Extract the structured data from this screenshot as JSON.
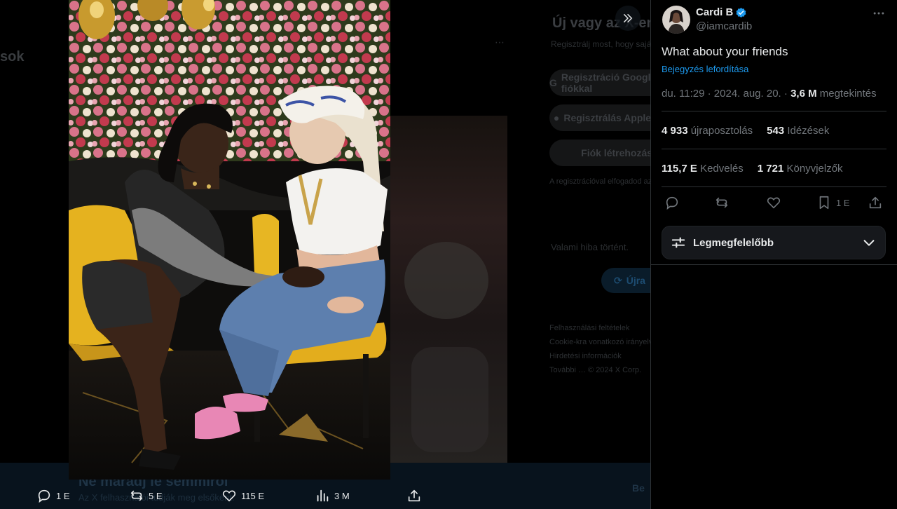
{
  "background": {
    "side_text": "sok",
    "signup_title": "Új vagy az X-en?",
    "signup_subtitle": "Regisztrálj most, hogy saját személyre szabott idővonalad lehessen!",
    "google_button": "Regisztráció Google-fiókkal",
    "apple_button": "Regisztrálás Apple-fiókkal",
    "create_account_button": "Fiók létrehozása",
    "fineprint": "A regisztrációval elfogadod az Általános Szerződési Feltételeket és az Adatvédelmi szabályzatot, beleértve a Cookie-k használatát.",
    "error_text": "Valami hiba történt.",
    "retry_button": "Újra",
    "footer_line1": "Felhasználási feltételek",
    "footer_line2": "Cookie-kra vonatkozó irányelv",
    "footer_line3": "Hirdetési információk",
    "footer_line4": "További … © 2024 X Corp.",
    "banner_title": "Ne maradj le semmiről",
    "banner_subtitle": "Az X felhasználói tudják meg elsőként.",
    "banner_button": "Be"
  },
  "media_bar": {
    "replies": "1 E",
    "reposts": "5 E",
    "likes": "115 E",
    "views": "3 M"
  },
  "tweet": {
    "display_name": "Cardi B",
    "handle": "@iamcardib",
    "text": "What about your friends",
    "translate_link": "Bejegyzés lefordítása",
    "time": "du. 11:29",
    "date": "2024. aug. 20.",
    "views_count": "3,6 M",
    "views_label": "megtekintés",
    "reposts_count": "4 933",
    "reposts_label": "újraposztolás",
    "quotes_count": "543",
    "quotes_label": "Idézések",
    "likes_count": "115,7 E",
    "likes_label": "Kedvelés",
    "bookmarks_count": "1 721",
    "bookmarks_label": "Könyvjelzők",
    "bookmark_action_count": "1 E"
  },
  "sort": {
    "label": "Legmegfelelőbb"
  },
  "colors": {
    "accent": "#1d9bf0",
    "text_primary": "#e7e9ea",
    "text_secondary": "#71767b",
    "border": "#2f3336"
  }
}
